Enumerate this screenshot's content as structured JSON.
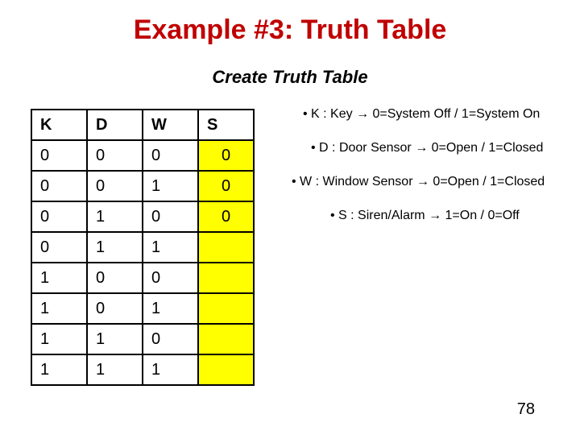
{
  "title": "Example #3: Truth Table",
  "subtitle": "Create Truth Table",
  "table": {
    "headers": [
      "K",
      "D",
      "W",
      "S"
    ],
    "rows": [
      {
        "k": "0",
        "d": "0",
        "w": "0",
        "s": "0"
      },
      {
        "k": "0",
        "d": "0",
        "w": "1",
        "s": "0"
      },
      {
        "k": "0",
        "d": "1",
        "w": "0",
        "s": "0"
      },
      {
        "k": "0",
        "d": "1",
        "w": "1",
        "s": ""
      },
      {
        "k": "1",
        "d": "0",
        "w": "0",
        "s": ""
      },
      {
        "k": "1",
        "d": "0",
        "w": "1",
        "s": ""
      },
      {
        "k": "1",
        "d": "1",
        "w": "0",
        "s": ""
      },
      {
        "k": "1",
        "d": "1",
        "w": "1",
        "s": ""
      }
    ]
  },
  "legend": [
    "K : Key → 0=System Off / 1=System On",
    "D : Door Sensor → 0=Open / 1=Closed",
    "W : Window Sensor → 0=Open / 1=Closed",
    "S : Siren/Alarm → 1=On / 0=Off"
  ],
  "page_number": "78"
}
